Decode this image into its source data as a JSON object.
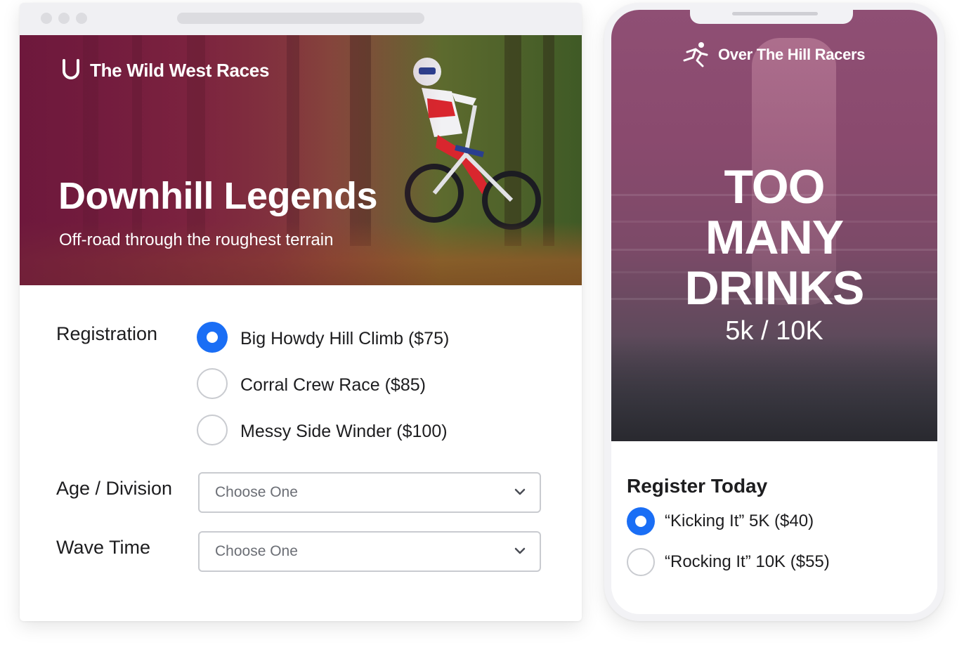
{
  "desktop": {
    "hero": {
      "brand": "The Wild West Races",
      "title": "Downhill Legends",
      "subtitle": "Off-road through the roughest terrain"
    },
    "form": {
      "registration_label": "Registration",
      "options": [
        {
          "label": "Big Howdy Hill Climb ($75)",
          "selected": true
        },
        {
          "label": "Corral Crew Race ($85)",
          "selected": false
        },
        {
          "label": "Messy Side Winder ($100)",
          "selected": false
        }
      ],
      "age_label": "Age / Division",
      "age_placeholder": "Choose One",
      "wave_label": "Wave Time",
      "wave_placeholder": "Choose One"
    }
  },
  "mobile": {
    "brand": "Over The Hill Racers",
    "headline": [
      "TOO",
      "MANY",
      "DRINKS"
    ],
    "distances": "5k / 10K",
    "register_title": "Register Today",
    "options": [
      {
        "label": "“Kicking It” 5K ($40)",
        "selected": true
      },
      {
        "label": "“Rocking It” 10K ($55)",
        "selected": false
      }
    ]
  },
  "colors": {
    "accent": "#1a6ef5",
    "hero_overlay": "#6e1a3f",
    "mobile_overlay": "#8f4f74"
  }
}
